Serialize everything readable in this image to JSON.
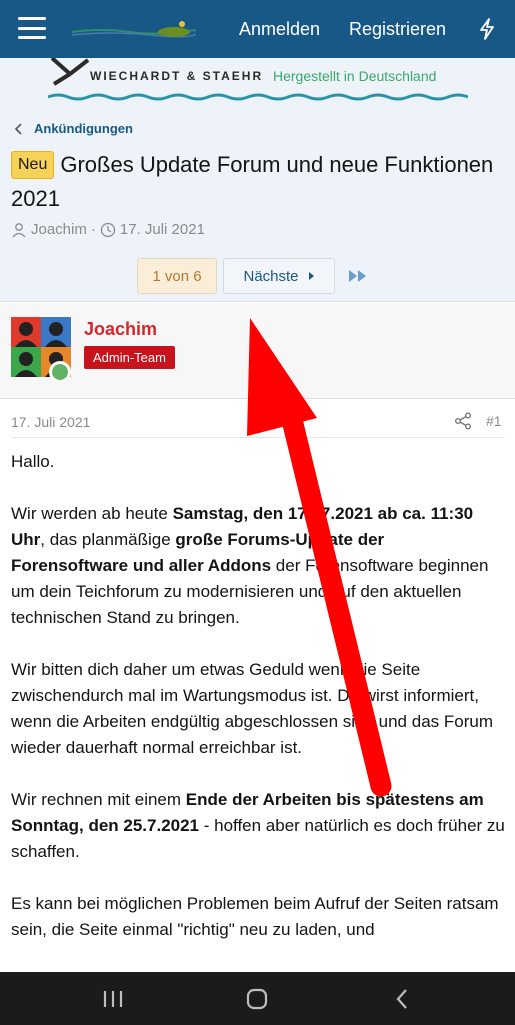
{
  "header": {
    "login": "Anmelden",
    "register": "Registrieren"
  },
  "banner": {
    "brand": "WIECHARDT & STAEHR",
    "tagline": "Hergestellt in Deutschland"
  },
  "thread": {
    "breadcrumb": "Ankündigungen",
    "prefix": "Neu",
    "title": "Großes Update Forum und neue Funktionen 2021",
    "author": "Joachim",
    "separator": "·",
    "date": "17. Juli 2021"
  },
  "pagination": {
    "current": "1 von 6",
    "next": "Nächste"
  },
  "post": {
    "username": "Joachim",
    "role": "Admin-Team",
    "date": "17. Juli 2021",
    "number": "#1",
    "greeting": "Hallo.",
    "p1_a": "Wir werden ab heute ",
    "p1_b": "Samstag, den 17.07.2021 ab ca. 11:30 Uhr",
    "p1_c": ", das planmäßige ",
    "p1_d": "große Forums-Update der Forensoftware und aller Addons",
    "p1_e": " der Forensoftware beginnen um dein Teichforum zu modernisieren und auf den aktuellen technischen Stand zu bringen.",
    "p2": "Wir bitten dich daher um etwas Geduld wenn die Seite zwischendurch mal im Wartungsmodus ist. Du wirst informiert, wenn die Arbeiten endgültig abgeschlossen sind und das Forum wieder dauerhaft normal erreichbar ist.",
    "p3_a": "Wir rechnen mit einem ",
    "p3_b": "Ende der Arbeiten bis spätestens am Sonntag, den 25.7.2021",
    "p3_c": " - hoffen aber natürlich es doch früher zu schaffen.",
    "p4": "Es kann bei möglichen Problemen beim Aufruf der Seiten ratsam sein, die Seite einmal \"richtig\" neu zu laden, und"
  },
  "colors": {
    "topbar": "#185886",
    "accent_red": "#d6262a",
    "arrow": "#ff0000"
  },
  "icons": [
    "menu-icon",
    "bolt-icon",
    "chevron-left-icon",
    "user-icon",
    "clock-icon",
    "chevron-right-icon",
    "fast-forward-icon",
    "share-icon",
    "recents-icon",
    "home-icon",
    "back-icon"
  ]
}
